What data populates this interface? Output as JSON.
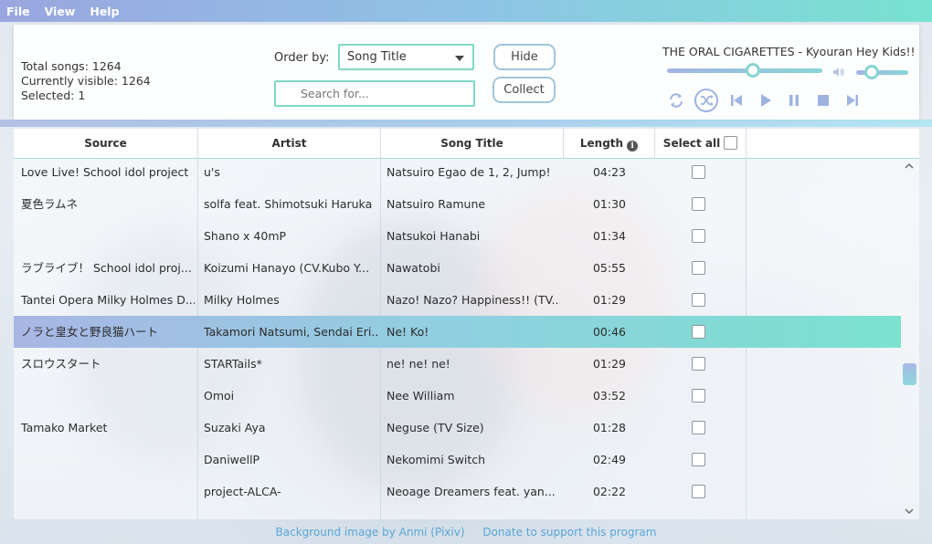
{
  "menu": [
    "File",
    "View",
    "Help"
  ],
  "stats": {
    "total": "Total songs: 1264",
    "visible": "Currently visible: 1264",
    "selected": "Selected: 1"
  },
  "order": {
    "label": "Order by:",
    "value": "Song Title"
  },
  "search": {
    "placeholder": "Search for..."
  },
  "buttons": {
    "hide": "Hide",
    "collect": "Collect"
  },
  "player": {
    "now_playing": "THE ORAL CIGARETTES - Kyouran Hey Kids!!",
    "progress": 0.55,
    "volume": 0.3
  },
  "table": {
    "headers": {
      "source": "Source",
      "artist": "Artist",
      "title": "Song Title",
      "length": "Length",
      "select_all": "Select all"
    },
    "rows": [
      {
        "source": "Love Live! School idol project",
        "artist": "u's",
        "title": "Natsuiro Egao de 1, 2, Jump!",
        "length": "04:23",
        "selected": false
      },
      {
        "source": "夏色ラムネ",
        "artist": "solfa feat. Shimotsuki Haruka",
        "title": "Natsuiro Ramune",
        "length": "01:30",
        "selected": false
      },
      {
        "source": "",
        "artist": "Shano x 40mP",
        "title": "Natsukoi Hanabi",
        "length": "01:34",
        "selected": false
      },
      {
        "source": "ラブライブ！ School idol proj...",
        "artist": "Koizumi Hanayo (CV.Kubo Y...",
        "title": "Nawatobi",
        "length": "05:55",
        "selected": false
      },
      {
        "source": "Tantei Opera Milky Holmes D...",
        "artist": "Milky Holmes",
        "title": "Nazo! Nazo? Happiness!! (TV...",
        "length": "01:29",
        "selected": false
      },
      {
        "source": "ノラと皇女と野良猫ハート",
        "artist": "Takamori Natsumi, Sendai Eri...",
        "title": "Ne! Ko!",
        "length": "00:46",
        "selected": true
      },
      {
        "source": "スロウスタート",
        "artist": "STARTails*",
        "title": "ne! ne! ne!",
        "length": "01:29",
        "selected": false
      },
      {
        "source": "",
        "artist": "Omoi",
        "title": "Nee William",
        "length": "03:52",
        "selected": false
      },
      {
        "source": "Tamako Market",
        "artist": "Suzaki Aya",
        "title": "Neguse (TV Size)",
        "length": "01:28",
        "selected": false
      },
      {
        "source": "",
        "artist": "DaniwellP",
        "title": "Nekomimi Switch",
        "length": "02:49",
        "selected": false
      },
      {
        "source": "",
        "artist": "project-ALCA-",
        "title": "Neoage Dreamers feat. yan...",
        "length": "02:22",
        "selected": false
      }
    ]
  },
  "footer": {
    "credit": "Background image by Anmi (Pixiv)",
    "donate": "Donate to support this program"
  },
  "colors": {
    "accent": "#7fd9c3",
    "menubar_start": "#9aa6df",
    "menubar_end": "#79e3d1",
    "link": "#5aa6d6"
  }
}
